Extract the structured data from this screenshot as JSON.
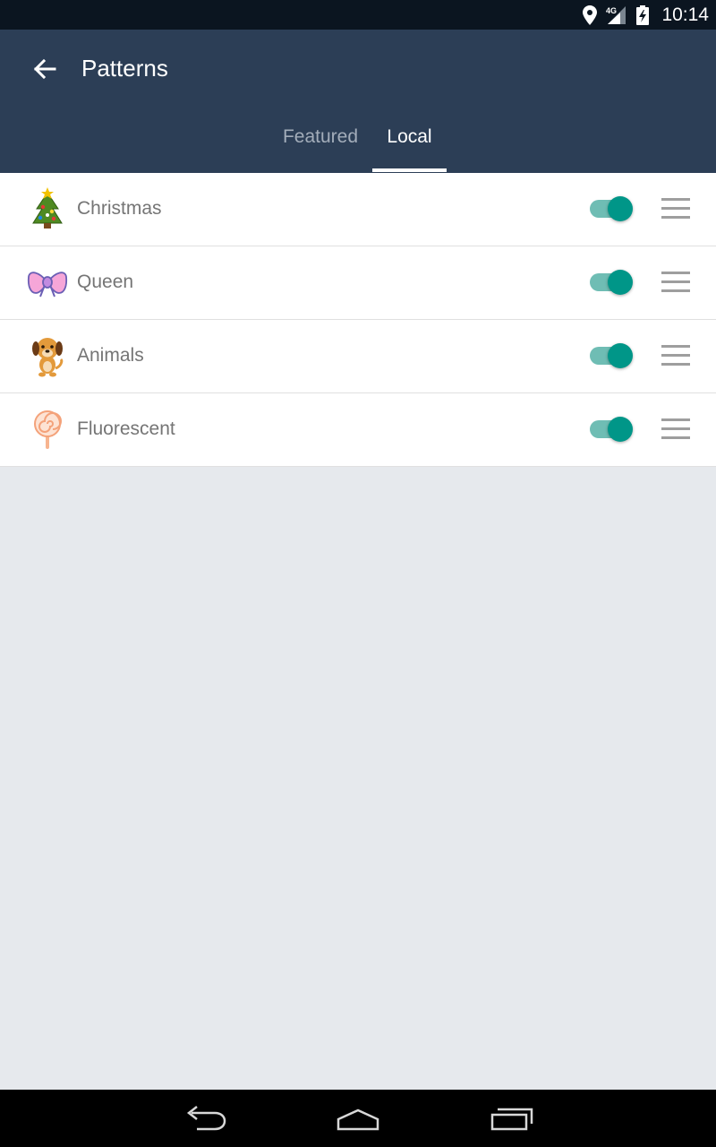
{
  "status_bar": {
    "time": "10:14",
    "network_label": "4G",
    "icons": [
      "location-icon",
      "signal-icon",
      "battery-charging-icon"
    ]
  },
  "app_bar": {
    "title": "Patterns",
    "back_icon": "arrow-left-icon"
  },
  "tabs": [
    {
      "label": "Featured",
      "selected": false
    },
    {
      "label": "Local",
      "selected": true
    }
  ],
  "patterns": [
    {
      "label": "Christmas",
      "icon": "christmas-tree-icon",
      "enabled": true
    },
    {
      "label": "Queen",
      "icon": "bow-icon",
      "enabled": true
    },
    {
      "label": "Animals",
      "icon": "puppy-icon",
      "enabled": true
    },
    {
      "label": "Fluorescent",
      "icon": "lollipop-icon",
      "enabled": true
    }
  ],
  "colors": {
    "app_bar": "#2c3e56",
    "status_bar": "#0b1520",
    "accent": "#009688",
    "accent_track": "#6fbdb4",
    "background": "#e6e9ed"
  },
  "nav_bar": {
    "icons": [
      "back-nav-icon",
      "home-nav-icon",
      "recents-nav-icon"
    ]
  }
}
